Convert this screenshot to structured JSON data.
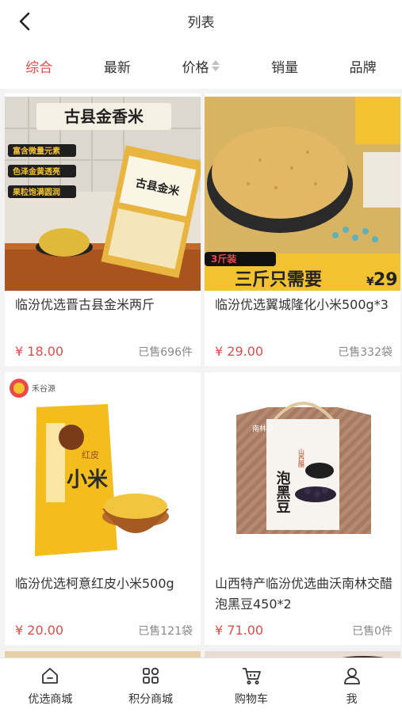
{
  "header": {
    "title": "列表"
  },
  "sortbar": {
    "items": [
      {
        "label": "综合",
        "active": true
      },
      {
        "label": "最新"
      },
      {
        "label": "价格"
      },
      {
        "label": "销量"
      },
      {
        "label": "品牌"
      }
    ]
  },
  "products": [
    {
      "name": "临汾优选晋古县金米两斤",
      "price": "¥ 18.00",
      "sold": "已售696件",
      "image_text": {
        "banner": "古县金香米",
        "tags": [
          "富含微量元素",
          "色泽金黄透亮",
          "果粒饱满圆润"
        ],
        "bag": "古县金米"
      }
    },
    {
      "name": "临汾优选翼城隆化小米500g*3",
      "price": "¥ 29.00",
      "sold": "已售332袋",
      "image_text": {
        "promo_tag": "3斤装",
        "promo": "三斤只需要",
        "promo_price": "29"
      }
    },
    {
      "name": "临汾优选柯意红皮小米500g",
      "price": "¥ 20.00",
      "sold": "已售121袋",
      "image_text": {
        "logo": "禾谷源",
        "bag": "小米",
        "bag_sub": "红皮"
      }
    },
    {
      "name": "山西特产临汾优选曲沃南林交醋泡黑豆450*2",
      "price": "¥ 71.00",
      "sold": "已售0件",
      "image_text": {
        "box": "泡黑豆",
        "box_side": "山西醋",
        "brand": "南林交"
      }
    }
  ],
  "bottom_nav": {
    "items": [
      {
        "label": "优选商城",
        "icon": "home-icon"
      },
      {
        "label": "积分商城",
        "icon": "grid-icon"
      },
      {
        "label": "购物车",
        "icon": "cart-icon"
      },
      {
        "label": "我",
        "icon": "user-icon"
      }
    ]
  },
  "colors": {
    "accent": "#e84a4a",
    "gold": "#f2c230",
    "text": "#333333",
    "muted": "#888888"
  }
}
